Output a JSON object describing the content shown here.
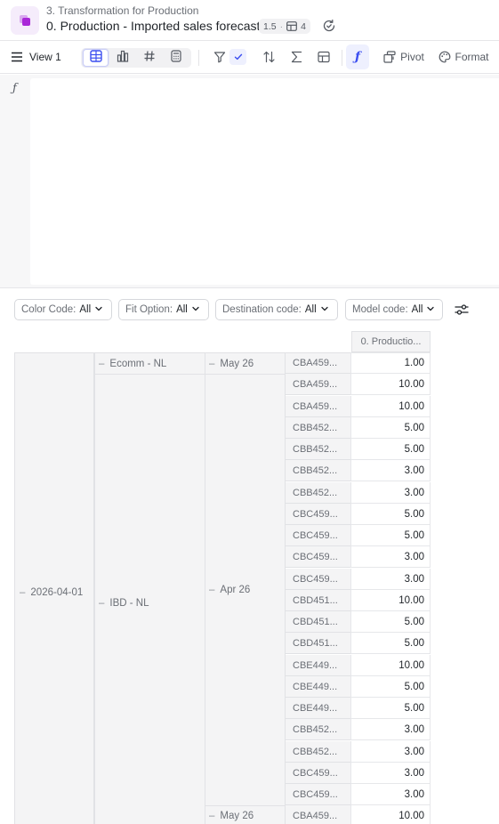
{
  "header": {
    "breadcrumb": "3. Transformation for Production",
    "title": "0. Production - Imported sales forecast",
    "version": "1.5",
    "view_count": "4"
  },
  "toolbar": {
    "view_label": "View 1",
    "pivot_label": "Pivot",
    "format_label": "Format"
  },
  "formula": {
    "fx_symbol": "ƒ",
    "content": ""
  },
  "filters": [
    {
      "label": "Color Code:",
      "value": "All"
    },
    {
      "label": "Fit Option:",
      "value": "All"
    },
    {
      "label": "Destination code:",
      "value": "All"
    },
    {
      "label": "Model code:",
      "value": "All"
    }
  ],
  "table": {
    "column_header": "0. Productio...",
    "date_group": "2026-04-01",
    "channel_groups": [
      "Ecomm - NL",
      "IBD - NL"
    ],
    "month_groups": [
      "May 26",
      "Apr 26",
      "May 26"
    ],
    "rows": [
      {
        "code": "CBA459...",
        "value": "1.00"
      },
      {
        "code": "CBA459...",
        "value": "10.00"
      },
      {
        "code": "CBA459...",
        "value": "10.00"
      },
      {
        "code": "CBB452...",
        "value": "5.00"
      },
      {
        "code": "CBB452...",
        "value": "5.00"
      },
      {
        "code": "CBB452...",
        "value": "3.00"
      },
      {
        "code": "CBB452...",
        "value": "3.00"
      },
      {
        "code": "CBC459...",
        "value": "5.00"
      },
      {
        "code": "CBC459...",
        "value": "5.00"
      },
      {
        "code": "CBC459...",
        "value": "3.00"
      },
      {
        "code": "CBC459...",
        "value": "3.00"
      },
      {
        "code": "CBD451...",
        "value": "10.00"
      },
      {
        "code": "CBD451...",
        "value": "5.00"
      },
      {
        "code": "CBD451...",
        "value": "5.00"
      },
      {
        "code": "CBE449...",
        "value": "10.00"
      },
      {
        "code": "CBE449...",
        "value": "5.00"
      },
      {
        "code": "CBE449...",
        "value": "5.00"
      },
      {
        "code": "CBB452...",
        "value": "3.00"
      },
      {
        "code": "CBB452...",
        "value": "3.00"
      },
      {
        "code": "CBC459...",
        "value": "3.00"
      },
      {
        "code": "CBC459...",
        "value": "3.00"
      },
      {
        "code": "CBA459...",
        "value": "10.00"
      }
    ]
  },
  "colors": {
    "accent": "#3b4ef0",
    "brand": "#a927d8"
  }
}
